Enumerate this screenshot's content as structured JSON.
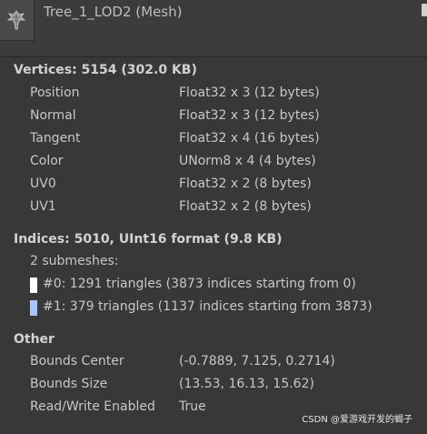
{
  "header": {
    "title": "Tree_1_LOD2 (Mesh)",
    "thumbnail_icon": "tree-mesh-icon"
  },
  "vertices": {
    "title": "Vertices: 5154 (302.0 KB)",
    "attributes": [
      {
        "name": "Position",
        "format": "Float32 x 3 (12 bytes)"
      },
      {
        "name": "Normal",
        "format": "Float32 x 3 (12 bytes)"
      },
      {
        "name": "Tangent",
        "format": "Float32 x 4 (16 bytes)"
      },
      {
        "name": "Color",
        "format": "UNorm8 x 4 (4 bytes)"
      },
      {
        "name": "UV0",
        "format": "Float32 x 2 (8 bytes)"
      },
      {
        "name": "UV1",
        "format": "Float32 x 2 (8 bytes)"
      }
    ]
  },
  "indices": {
    "title": "Indices: 5010, UInt16 format (9.8 KB)",
    "submesh_count": "2 submeshes:",
    "submeshes": [
      {
        "text": "#0: 1291 triangles (3873 indices starting from 0)",
        "color": "#ffffff"
      },
      {
        "text": "#1: 379 triangles (1137 indices starting from 3873)",
        "color": "#aac4ff"
      }
    ]
  },
  "other": {
    "title": "Other",
    "rows": [
      {
        "name": "Bounds Center",
        "value": "(-0.7889, 7.125, 0.2714)"
      },
      {
        "name": "Bounds Size",
        "value": "(13.53, 16.13, 15.62)"
      },
      {
        "name": "Read/Write Enabled",
        "value": "True"
      }
    ]
  },
  "watermark": "CSDN @爱游戏开发的蝎子"
}
